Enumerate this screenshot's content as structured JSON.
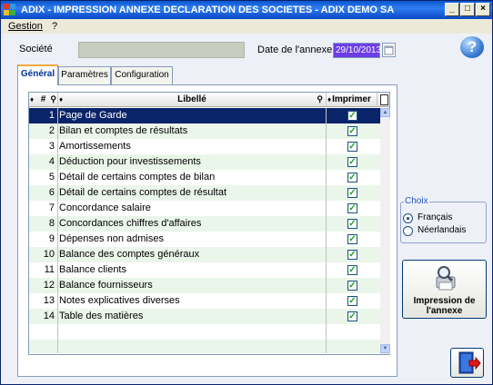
{
  "window": {
    "title": "ADIX - IMPRESSION ANNEXE DECLARATION DES SOCIETES - ADIX DEMO SA"
  },
  "menu": {
    "items": [
      "Gestion",
      "?"
    ]
  },
  "form": {
    "societe_label": "Société",
    "societe_value": "",
    "date_label": "Date de l'annexe",
    "date_value": "29/10/2013"
  },
  "tabs": [
    {
      "label": "Général",
      "active": true
    },
    {
      "label": "Paramètres",
      "active": false
    },
    {
      "label": "Configuration",
      "active": false
    }
  ],
  "grid": {
    "columns": {
      "num": "#",
      "libelle": "Libellé",
      "imprimer": "Imprimer"
    },
    "rows": [
      {
        "num": "1",
        "libelle": "Page de Garde",
        "imprimer": true,
        "selected": true
      },
      {
        "num": "2",
        "libelle": "Bilan et comptes de résultats",
        "imprimer": true
      },
      {
        "num": "3",
        "libelle": "Amortissements",
        "imprimer": true
      },
      {
        "num": "4",
        "libelle": "Déduction pour investissements",
        "imprimer": true
      },
      {
        "num": "5",
        "libelle": "Détail de certains comptes de bilan",
        "imprimer": true
      },
      {
        "num": "6",
        "libelle": "Détail de certains comptes de résultat",
        "imprimer": true
      },
      {
        "num": "7",
        "libelle": "Concordance salaire",
        "imprimer": true
      },
      {
        "num": "8",
        "libelle": "Concordances chiffres d'affaires",
        "imprimer": true
      },
      {
        "num": "9",
        "libelle": "Dépenses non admises",
        "imprimer": true
      },
      {
        "num": "10",
        "libelle": "Balance des comptes généraux",
        "imprimer": true
      },
      {
        "num": "11",
        "libelle": "Balance clients",
        "imprimer": true
      },
      {
        "num": "12",
        "libelle": "Balance fournisseurs",
        "imprimer": true
      },
      {
        "num": "13",
        "libelle": "Notes explicatives diverses",
        "imprimer": true
      },
      {
        "num": "14",
        "libelle": "Table des matières",
        "imprimer": true
      }
    ]
  },
  "choix": {
    "title": "Choix",
    "options": [
      {
        "label": "Français",
        "selected": true
      },
      {
        "label": "Néerlandais",
        "selected": false
      }
    ]
  },
  "buttons": {
    "impression_line1": "Impression de",
    "impression_line2": "l'annexe"
  },
  "colors": {
    "selection": "#0a246a",
    "date_field": "#6d3ee8",
    "titlebar": "#0a56d0"
  }
}
